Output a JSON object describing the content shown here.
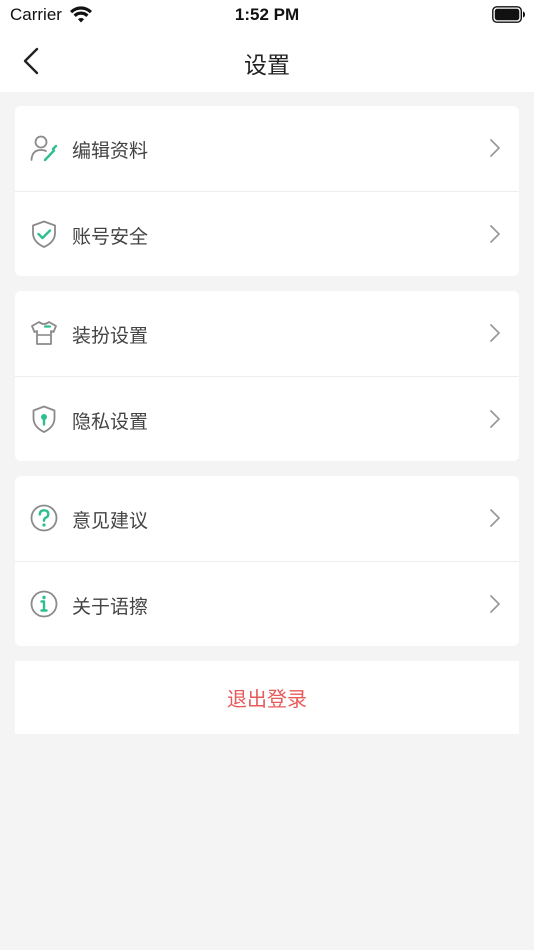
{
  "status_bar": {
    "carrier": "Carrier",
    "time": "1:52 PM"
  },
  "nav": {
    "title": "设置"
  },
  "groups": [
    {
      "items": [
        {
          "label": "编辑资料",
          "icon": "edit-profile-icon"
        },
        {
          "label": "账号安全",
          "icon": "shield-check-icon"
        }
      ]
    },
    {
      "items": [
        {
          "label": "装扮设置",
          "icon": "tshirt-icon"
        },
        {
          "label": "隐私设置",
          "icon": "privacy-lock-icon"
        }
      ]
    },
    {
      "items": [
        {
          "label": "意见建议",
          "icon": "question-circle-icon"
        },
        {
          "label": "关于语擦",
          "icon": "info-circle-icon"
        }
      ]
    }
  ],
  "logout": {
    "label": "退出登录"
  },
  "colors": {
    "accent_green": "#2fbf8f",
    "icon_gray": "#8a8a8a",
    "logout_red": "#e85a5a",
    "background": "#f4f4f4"
  }
}
